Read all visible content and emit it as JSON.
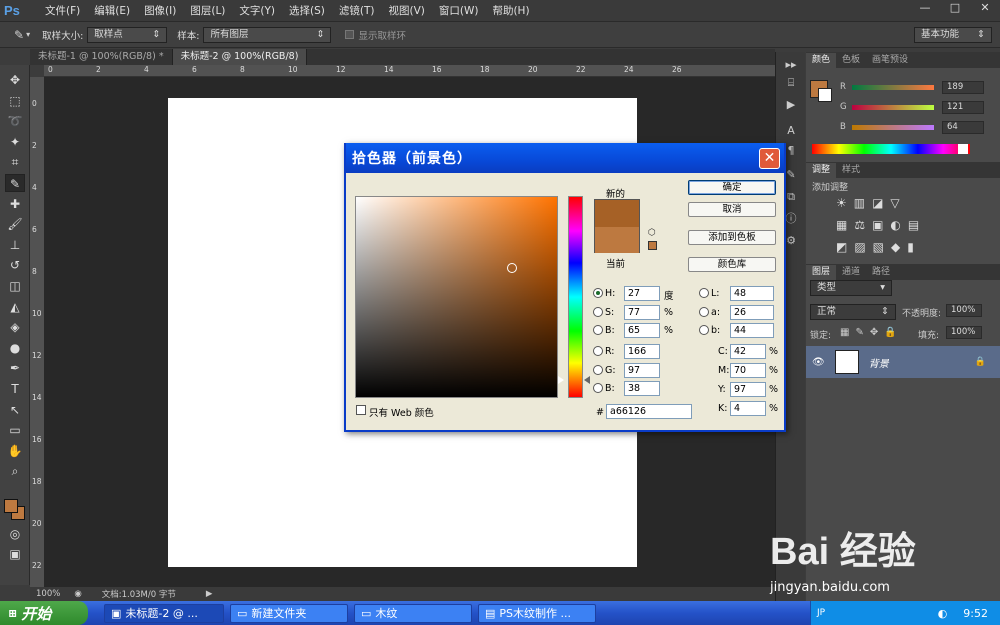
{
  "app": {
    "logo": "Ps",
    "menus": [
      "文件(F)",
      "编辑(E)",
      "图像(I)",
      "图层(L)",
      "文字(Y)",
      "选择(S)",
      "滤镜(T)",
      "视图(V)",
      "窗口(W)",
      "帮助(H)"
    ],
    "window_controls": [
      "—",
      "□",
      "✕"
    ]
  },
  "options": {
    "sample_size_label": "取样大小:",
    "sample_size_value": "取样点",
    "sample_label": "样本:",
    "sample_value": "所有图层",
    "show_ring_label": "显示取样环",
    "workspace": "基本功能"
  },
  "tabs": [
    {
      "label": "未标题-1 @ 100%(RGB/8) *"
    },
    {
      "label": "未标题-2 @ 100%(RGB/8)"
    }
  ],
  "ruler_h": [
    "0",
    "2",
    "4",
    "6",
    "8",
    "10",
    "12",
    "14",
    "16",
    "18",
    "20",
    "22",
    "24",
    "26"
  ],
  "ruler_v": [
    "0",
    "2",
    "4",
    "6",
    "8",
    "10",
    "12",
    "14",
    "16",
    "18",
    "20",
    "22"
  ],
  "status": {
    "zoom": "100%",
    "doc": "文档:1.03M/0 字节"
  },
  "panels": {
    "color_tabs": [
      "颜色",
      "色板",
      "画笔预设"
    ],
    "r_label": "R",
    "g_label": "G",
    "b_label": "B",
    "r": "189",
    "g": "121",
    "b": "64",
    "adjust_tabs": [
      "调整",
      "样式"
    ],
    "adjust_title": "添加调整",
    "layers_tabs": [
      "图层",
      "通道",
      "路径"
    ],
    "layer_filter": "类型",
    "blend_mode": "正常",
    "opacity_label": "不透明度:",
    "opacity": "100%",
    "lock_label": "锁定:",
    "fill_label": "填充:",
    "fill": "100%",
    "layer_name": "背景"
  },
  "dialog": {
    "title": "拾色器（前景色）",
    "new_label": "新的",
    "current_label": "当前",
    "ok": "确定",
    "cancel": "取消",
    "add_swatch": "添加到色板",
    "libraries": "颜色库",
    "hsb": [
      {
        "k": "H:",
        "v": "27",
        "u": "度"
      },
      {
        "k": "S:",
        "v": "77",
        "u": "%"
      },
      {
        "k": "B:",
        "v": "65",
        "u": "%"
      }
    ],
    "rgb": [
      {
        "k": "R:",
        "v": "166"
      },
      {
        "k": "G:",
        "v": "97"
      },
      {
        "k": "B:",
        "v": "38"
      }
    ],
    "lab": [
      {
        "k": "L:",
        "v": "48"
      },
      {
        "k": "a:",
        "v": "26"
      },
      {
        "k": "b:",
        "v": "44"
      }
    ],
    "cmyk": [
      {
        "k": "C:",
        "v": "42",
        "u": "%"
      },
      {
        "k": "M:",
        "v": "70",
        "u": "%"
      },
      {
        "k": "Y:",
        "v": "97",
        "u": "%"
      },
      {
        "k": "K:",
        "v": "4",
        "u": "%"
      }
    ],
    "hex_label": "#",
    "hex": "a66126",
    "web_only": "只有 Web 颜色",
    "new_color": "#a66126",
    "current_color": "#bd7940"
  },
  "taskbar": {
    "start": "开始",
    "items": [
      "未标题-2 @ ...",
      "新建文件夹",
      "木纹",
      "PS木纹制作 ..."
    ],
    "ime": "JP",
    "time": "9:52"
  },
  "watermark": {
    "brand": "Bai 经验",
    "url": "jingyan.baidu.com"
  }
}
